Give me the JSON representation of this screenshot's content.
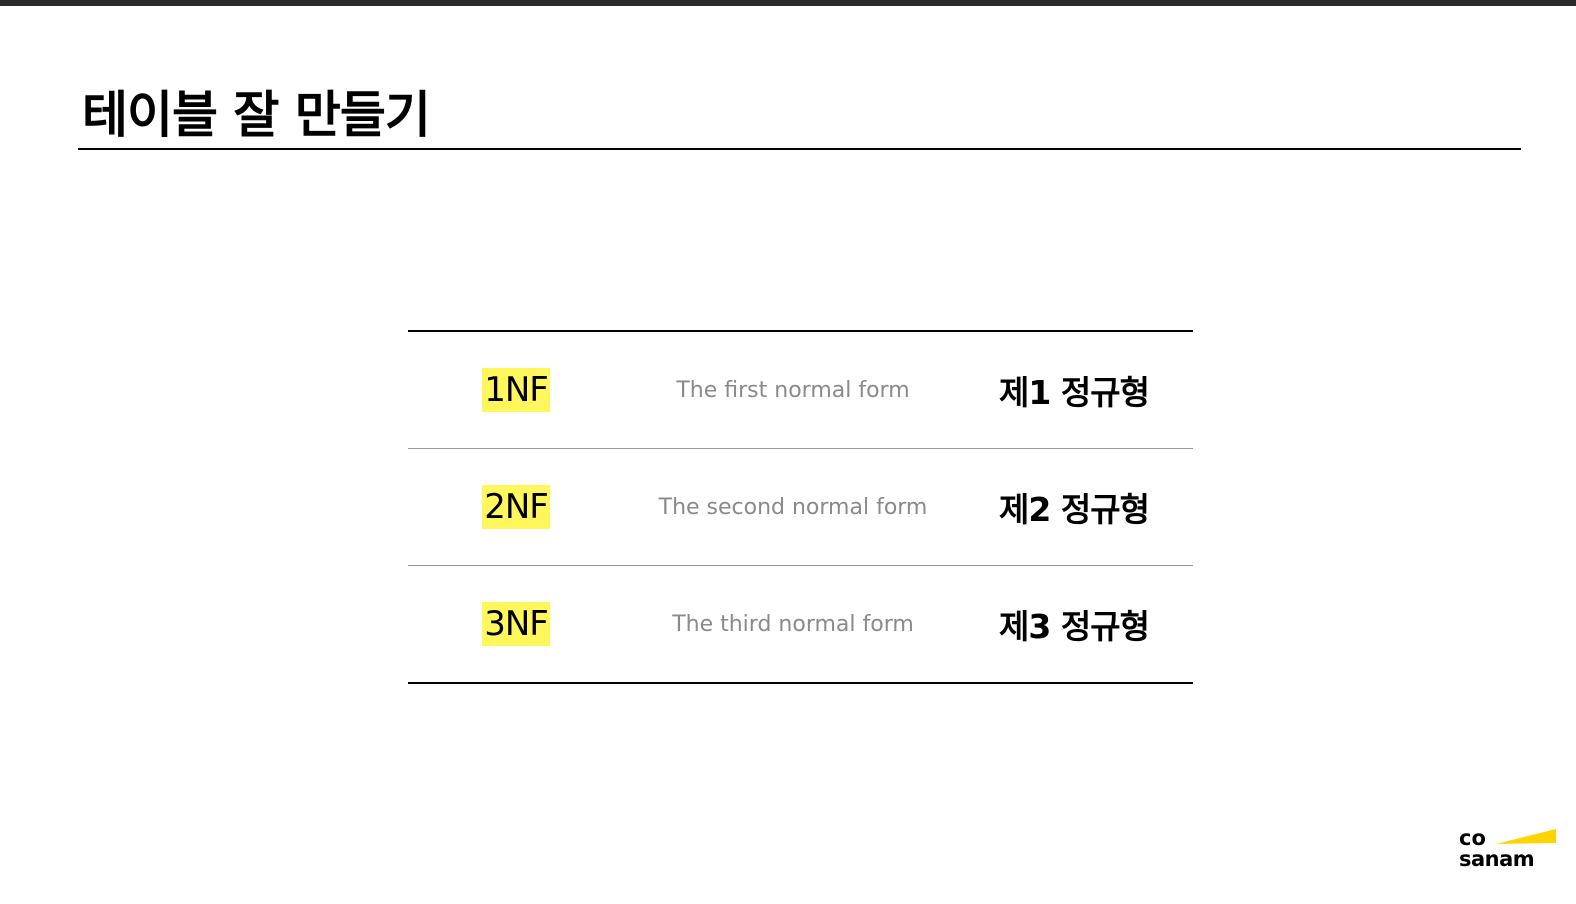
{
  "page": {
    "title": "테이블 잘 만들기"
  },
  "table": {
    "rows": [
      {
        "abbr": "1NF",
        "english": "The first normal form",
        "korean": "제1 정규형"
      },
      {
        "abbr": "2NF",
        "english": "The second normal form",
        "korean": "제2 정규형"
      },
      {
        "abbr": "3NF",
        "english": "The third normal form",
        "korean": "제3 정규형"
      }
    ],
    "highlight_color": "#fff75c"
  },
  "logo": {
    "line1": "co",
    "line2": "sanam",
    "accent_color": "#ffd400"
  }
}
